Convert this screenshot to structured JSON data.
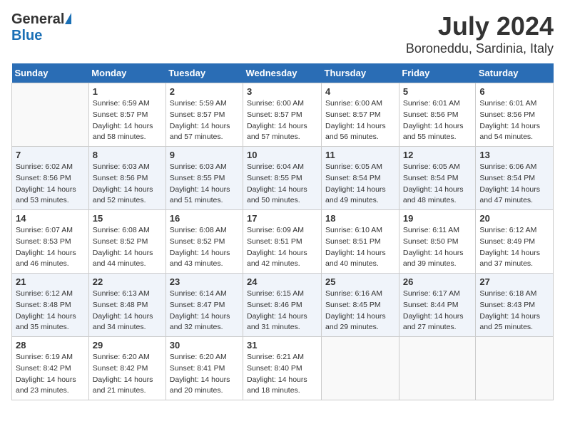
{
  "header": {
    "logo_general": "General",
    "logo_blue": "Blue",
    "month_title": "July 2024",
    "location": "Boroneddu, Sardinia, Italy"
  },
  "days_of_week": [
    "Sunday",
    "Monday",
    "Tuesday",
    "Wednesday",
    "Thursday",
    "Friday",
    "Saturday"
  ],
  "weeks": [
    [
      {
        "day": "",
        "empty": true
      },
      {
        "day": "1",
        "sunrise": "6:59 AM",
        "sunset": "8:57 PM",
        "daylight": "14 hours and 58 minutes."
      },
      {
        "day": "2",
        "sunrise": "5:59 AM",
        "sunset": "8:57 PM",
        "daylight": "14 hours and 57 minutes."
      },
      {
        "day": "3",
        "sunrise": "6:00 AM",
        "sunset": "8:57 PM",
        "daylight": "14 hours and 57 minutes."
      },
      {
        "day": "4",
        "sunrise": "6:00 AM",
        "sunset": "8:57 PM",
        "daylight": "14 hours and 56 minutes."
      },
      {
        "day": "5",
        "sunrise": "6:01 AM",
        "sunset": "8:56 PM",
        "daylight": "14 hours and 55 minutes."
      },
      {
        "day": "6",
        "sunrise": "6:01 AM",
        "sunset": "8:56 PM",
        "daylight": "14 hours and 54 minutes."
      }
    ],
    [
      {
        "day": "7",
        "sunrise": "6:02 AM",
        "sunset": "8:56 PM",
        "daylight": "14 hours and 53 minutes."
      },
      {
        "day": "8",
        "sunrise": "6:03 AM",
        "sunset": "8:56 PM",
        "daylight": "14 hours and 52 minutes."
      },
      {
        "day": "9",
        "sunrise": "6:03 AM",
        "sunset": "8:55 PM",
        "daylight": "14 hours and 51 minutes."
      },
      {
        "day": "10",
        "sunrise": "6:04 AM",
        "sunset": "8:55 PM",
        "daylight": "14 hours and 50 minutes."
      },
      {
        "day": "11",
        "sunrise": "6:05 AM",
        "sunset": "8:54 PM",
        "daylight": "14 hours and 49 minutes."
      },
      {
        "day": "12",
        "sunrise": "6:05 AM",
        "sunset": "8:54 PM",
        "daylight": "14 hours and 48 minutes."
      },
      {
        "day": "13",
        "sunrise": "6:06 AM",
        "sunset": "8:54 PM",
        "daylight": "14 hours and 47 minutes."
      }
    ],
    [
      {
        "day": "14",
        "sunrise": "6:07 AM",
        "sunset": "8:53 PM",
        "daylight": "14 hours and 46 minutes."
      },
      {
        "day": "15",
        "sunrise": "6:08 AM",
        "sunset": "8:52 PM",
        "daylight": "14 hours and 44 minutes."
      },
      {
        "day": "16",
        "sunrise": "6:08 AM",
        "sunset": "8:52 PM",
        "daylight": "14 hours and 43 minutes."
      },
      {
        "day": "17",
        "sunrise": "6:09 AM",
        "sunset": "8:51 PM",
        "daylight": "14 hours and 42 minutes."
      },
      {
        "day": "18",
        "sunrise": "6:10 AM",
        "sunset": "8:51 PM",
        "daylight": "14 hours and 40 minutes."
      },
      {
        "day": "19",
        "sunrise": "6:11 AM",
        "sunset": "8:50 PM",
        "daylight": "14 hours and 39 minutes."
      },
      {
        "day": "20",
        "sunrise": "6:12 AM",
        "sunset": "8:49 PM",
        "daylight": "14 hours and 37 minutes."
      }
    ],
    [
      {
        "day": "21",
        "sunrise": "6:12 AM",
        "sunset": "8:48 PM",
        "daylight": "14 hours and 35 minutes."
      },
      {
        "day": "22",
        "sunrise": "6:13 AM",
        "sunset": "8:48 PM",
        "daylight": "14 hours and 34 minutes."
      },
      {
        "day": "23",
        "sunrise": "6:14 AM",
        "sunset": "8:47 PM",
        "daylight": "14 hours and 32 minutes."
      },
      {
        "day": "24",
        "sunrise": "6:15 AM",
        "sunset": "8:46 PM",
        "daylight": "14 hours and 31 minutes."
      },
      {
        "day": "25",
        "sunrise": "6:16 AM",
        "sunset": "8:45 PM",
        "daylight": "14 hours and 29 minutes."
      },
      {
        "day": "26",
        "sunrise": "6:17 AM",
        "sunset": "8:44 PM",
        "daylight": "14 hours and 27 minutes."
      },
      {
        "day": "27",
        "sunrise": "6:18 AM",
        "sunset": "8:43 PM",
        "daylight": "14 hours and 25 minutes."
      }
    ],
    [
      {
        "day": "28",
        "sunrise": "6:19 AM",
        "sunset": "8:42 PM",
        "daylight": "14 hours and 23 minutes."
      },
      {
        "day": "29",
        "sunrise": "6:20 AM",
        "sunset": "8:42 PM",
        "daylight": "14 hours and 21 minutes."
      },
      {
        "day": "30",
        "sunrise": "6:20 AM",
        "sunset": "8:41 PM",
        "daylight": "14 hours and 20 minutes."
      },
      {
        "day": "31",
        "sunrise": "6:21 AM",
        "sunset": "8:40 PM",
        "daylight": "14 hours and 18 minutes."
      },
      {
        "day": "",
        "empty": true
      },
      {
        "day": "",
        "empty": true
      },
      {
        "day": "",
        "empty": true
      }
    ]
  ],
  "labels": {
    "sunrise": "Sunrise:",
    "sunset": "Sunset:",
    "daylight": "Daylight:"
  }
}
